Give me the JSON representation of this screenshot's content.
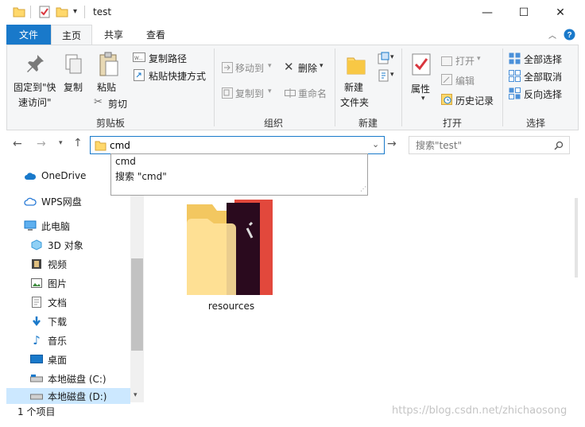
{
  "window": {
    "title": "test",
    "minimize": "—",
    "maximize": "☐",
    "close": "✕"
  },
  "tabs": [
    "文件",
    "主页",
    "共享",
    "查看"
  ],
  "ribbon": {
    "clipboard": {
      "pin": "固定到\"快",
      "pin2": "速访问\"",
      "copy": "复制",
      "paste": "粘贴",
      "cut": "剪切",
      "copy_path": "复制路径",
      "paste_shortcut": "粘贴快捷方式",
      "group": "剪贴板"
    },
    "organize": {
      "move_to": "移动到",
      "copy_to": "复制到",
      "delete": "删除",
      "rename": "重命名",
      "group": "组织"
    },
    "new": {
      "new_folder1": "新建",
      "new_folder2": "文件夹",
      "group": "新建"
    },
    "open": {
      "properties": "属性",
      "open": "打开",
      "edit": "编辑",
      "history": "历史记录",
      "group": "打开"
    },
    "select": {
      "select_all": "全部选择",
      "select_none": "全部取消",
      "invert": "反向选择",
      "group": "选择"
    }
  },
  "address": {
    "value": "cmd"
  },
  "search": {
    "placeholder": "搜索\"test\""
  },
  "autocomplete": [
    "cmd",
    "搜索 \"cmd\""
  ],
  "sidebar": {
    "items": [
      {
        "label": "OneDrive",
        "icon": "cloud-icon"
      },
      {
        "label": "WPS网盘",
        "icon": "cloud-outline-icon"
      },
      {
        "label": "此电脑",
        "icon": "computer-icon"
      },
      {
        "label": "3D 对象",
        "icon": "cube-icon"
      },
      {
        "label": "视频",
        "icon": "video-icon"
      },
      {
        "label": "图片",
        "icon": "picture-icon"
      },
      {
        "label": "文档",
        "icon": "document-icon"
      },
      {
        "label": "下载",
        "icon": "download-icon"
      },
      {
        "label": "音乐",
        "icon": "music-icon"
      },
      {
        "label": "桌面",
        "icon": "desktop-icon"
      },
      {
        "label": "本地磁盘 (C:)",
        "icon": "drive-icon"
      },
      {
        "label": "本地磁盘 (D:)",
        "icon": "drive-icon"
      }
    ]
  },
  "files": [
    {
      "name": "resources",
      "icon": "folder-icon"
    }
  ],
  "status": {
    "count": "1 个项目"
  },
  "watermark": "https://blog.csdn.net/zhichaosong"
}
